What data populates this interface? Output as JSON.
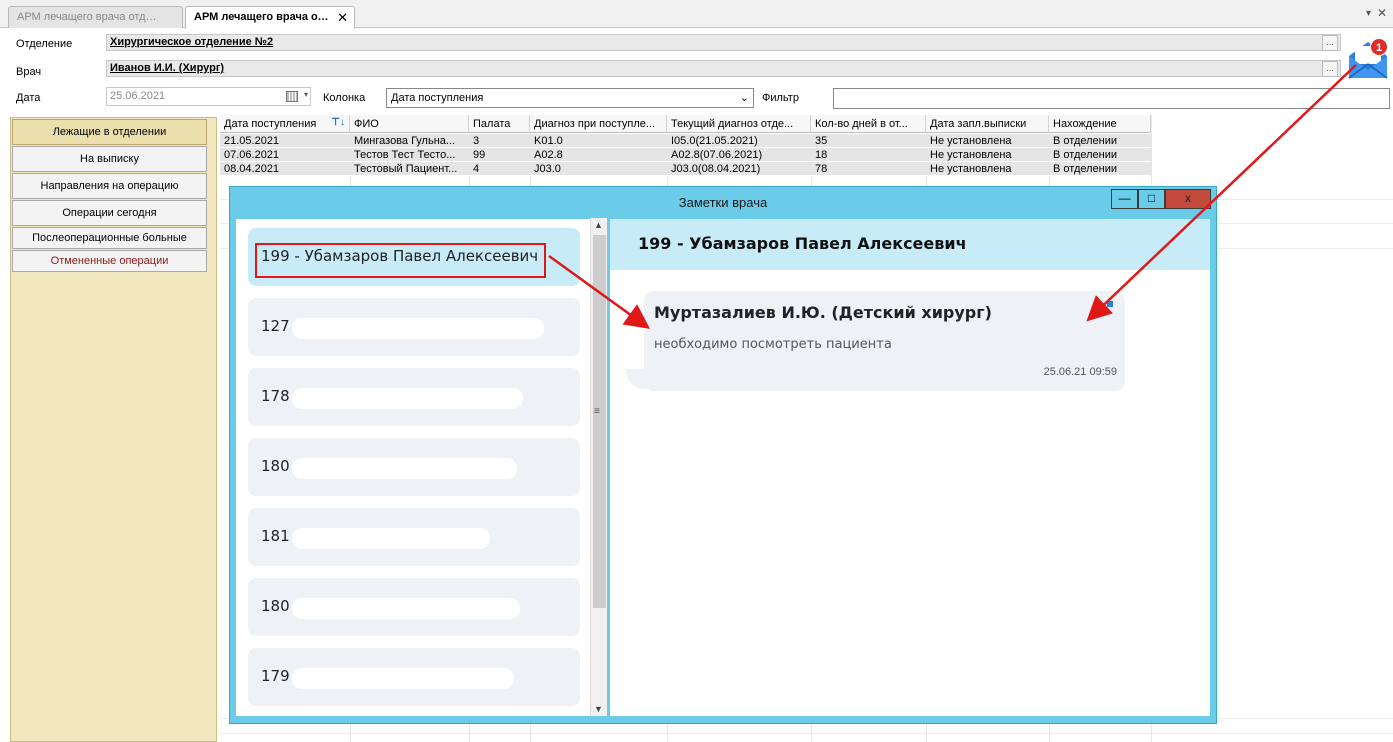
{
  "tabs": [
    {
      "label": "АРМ лечащего врача отде..."
    },
    {
      "label": "АРМ лечащего врача отд..",
      "close": "✕"
    }
  ],
  "form": {
    "department_label": "Отделение",
    "department_value": "Хирургическое отделение №2",
    "doctor_label": "Врач",
    "doctor_value": "Иванов И.И. (Хирург)",
    "date_label": "Дата",
    "date_value": "25.06.2021",
    "column_label": "Колонка",
    "column_value": "Дата поступления",
    "filter_label": "Фильтр",
    "filter_value": "",
    "ellipsis": "..."
  },
  "mail": {
    "badge": "1",
    "icon": "mail-envelope-icon"
  },
  "nav": [
    {
      "label": "Лежащие в отделении"
    },
    {
      "label": "На выписку"
    },
    {
      "label": "Направления на операцию"
    },
    {
      "label": "Операции сегодня"
    },
    {
      "label": "Послеоперационные больные"
    },
    {
      "label": "Отмененные операции"
    }
  ],
  "grid": {
    "headers": [
      "Дата поступления",
      "ФИО",
      "Палата",
      "Диагноз при поступле...",
      "Текущий диагноз отде...",
      "Кол-во дней в от...",
      "Дата запл.выписки",
      "Нахождение"
    ],
    "rows": [
      [
        "21.05.2021",
        "Мингазова Гульна...",
        "3",
        "K01.0",
        "I05.0(21.05.2021)",
        "35",
        "Не установлена",
        "В отделении"
      ],
      [
        "07.06.2021",
        "Тестов Тест Тесто...",
        "99",
        "A02.8",
        "A02.8(07.06.2021)",
        "18",
        "Не установлена",
        "В отделении"
      ],
      [
        "08.04.2021",
        "Тестовый Пациент...",
        "4",
        "J03.0",
        "J03.0(08.04.2021)",
        "78",
        "Не установлена",
        "В отделении"
      ]
    ]
  },
  "dialog": {
    "title": "Заметки врача",
    "minimize": "—",
    "maximize": "□",
    "close": "x",
    "chats": [
      {
        "label": "199 - Убамзаров Павел Алексеевич"
      },
      {
        "label": "127"
      },
      {
        "label": "178"
      },
      {
        "label": "180"
      },
      {
        "label": "181"
      },
      {
        "label": "180"
      },
      {
        "label": "179"
      }
    ],
    "conversation_title": "199 - Убамзаров Павел Алексеевич",
    "message": {
      "author": "Муртазалиев И.Ю. (Детский хирург)",
      "text": "необходимо посмотреть пациента",
      "time": "25.06.21 09:59"
    }
  },
  "colors": {
    "accent": "#6acce8",
    "highlight": "#e01818",
    "nav_bg": "#f2e8c0"
  }
}
